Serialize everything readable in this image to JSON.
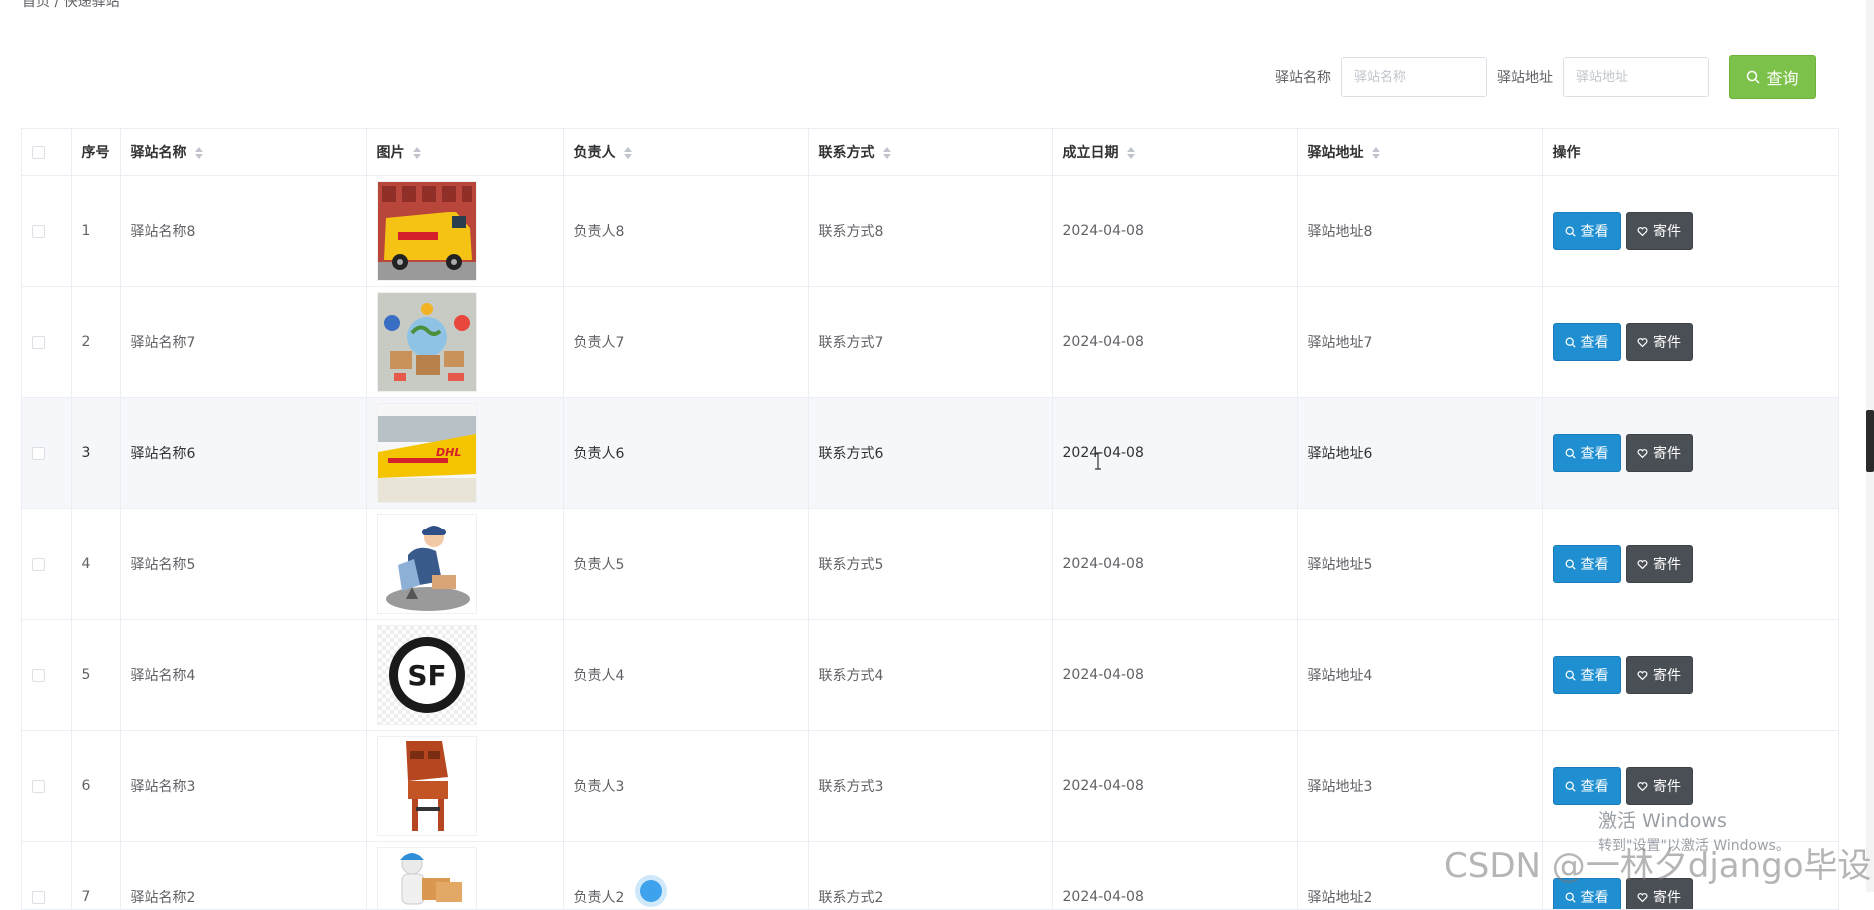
{
  "breadcrumb": "首页 / 快递驿站",
  "search": {
    "name_label": "驿站名称",
    "name_placeholder": "驿站名称",
    "address_label": "驿站地址",
    "address_placeholder": "驿站地址",
    "query_button": "查询"
  },
  "table": {
    "headers": {
      "index": "序号",
      "name": "驿站名称",
      "image": "图片",
      "manager": "负责人",
      "contact": "联系方式",
      "date": "成立日期",
      "address": "驿站地址",
      "actions": "操作"
    },
    "view_button": "查看",
    "send_button": "寄件",
    "rows": [
      {
        "index": "1",
        "name": "驿站名称8",
        "image": "dhl-van",
        "manager": "负责人8",
        "contact": "联系方式8",
        "date": "2024-04-08",
        "address": "驿站地址8"
      },
      {
        "index": "2",
        "name": "驿站名称7",
        "image": "global-parcels",
        "manager": "负责人7",
        "contact": "联系方式7",
        "date": "2024-04-08",
        "address": "驿站地址7"
      },
      {
        "index": "3",
        "name": "驿站名称6",
        "image": "dhl-truck",
        "manager": "负责人6",
        "contact": "联系方式6",
        "date": "2024-04-08",
        "address": "驿站地址6"
      },
      {
        "index": "4",
        "name": "驿站名称5",
        "image": "courier-worker",
        "manager": "负责人5",
        "contact": "联系方式5",
        "date": "2024-04-08",
        "address": "驿站地址5"
      },
      {
        "index": "5",
        "name": "驿站名称4",
        "image": "sf-logo",
        "manager": "负责人4",
        "contact": "联系方式4",
        "date": "2024-04-08",
        "address": "驿站地址4"
      },
      {
        "index": "6",
        "name": "驿站名称3",
        "image": "parcel-locker",
        "manager": "负责人3",
        "contact": "联系方式3",
        "date": "2024-04-08",
        "address": "驿站地址3"
      },
      {
        "index": "7",
        "name": "驿站名称2",
        "image": "delivery-figure",
        "manager": "负责人2",
        "contact": "联系方式2",
        "date": "2024-04-08",
        "address": "驿站地址2"
      }
    ]
  },
  "watermarks": {
    "windows_line1": "激活 Windows",
    "windows_line2": "转到\"设置\"以激活 Windows。",
    "csdn": "CSDN @一林夕django毕设",
    "sf_logo_text": "SF"
  },
  "colors": {
    "query_button": "#7cc24a",
    "view_button": "#1f8fd1",
    "send_button": "#4a4f55",
    "highlight_row": "#f5f7fa"
  }
}
